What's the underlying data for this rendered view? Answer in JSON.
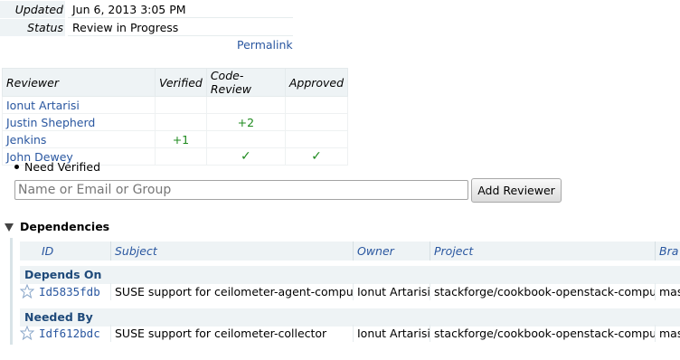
{
  "info": {
    "updated_label": "Updated",
    "updated_value": "Jun 6, 2013 3:05 PM",
    "status_label": "Status",
    "status_value": "Review in Progress",
    "permalink": "Permalink"
  },
  "reviewers": {
    "headers": [
      "Reviewer",
      "Verified",
      "Code-Review",
      "Approved"
    ],
    "rows": [
      {
        "name": "Ionut Artarisi",
        "verified": "",
        "code_review": "",
        "approved": ""
      },
      {
        "name": "Justin Shepherd",
        "verified": "",
        "code_review": "+2",
        "approved": ""
      },
      {
        "name": "Jenkins",
        "verified": "+1",
        "code_review": "",
        "approved": ""
      },
      {
        "name": "John Dewey",
        "verified": "",
        "code_review": "✓",
        "approved": "✓"
      }
    ]
  },
  "need_verified": "Need Verified",
  "add_reviewer": {
    "placeholder": "Name or Email or Group",
    "button": "Add Reviewer"
  },
  "dependencies": {
    "title": "Dependencies",
    "headers": [
      "ID",
      "Subject",
      "Owner",
      "Project",
      "Bra"
    ],
    "depends_on_label": "Depends On",
    "depends_on": [
      {
        "id": "Id5835fdb",
        "subject": "SUSE support for ceilometer-agent-compute",
        "owner": "Ionut Artarisi",
        "project": "stackforge/cookbook-openstack-compute",
        "branch": "mas"
      }
    ],
    "needed_by_label": "Needed By",
    "needed_by": [
      {
        "id": "Idf612bdc",
        "subject": "SUSE support for ceilometer-collector",
        "owner": "Ionut Artarisi",
        "project": "stackforge/cookbook-openstack-compute",
        "branch": "mas"
      }
    ]
  },
  "colors": {
    "link": "#2a57a0",
    "approval_green": "#1d8a1d",
    "header_bg": "#eef3f5"
  },
  "icons": [
    "star-icon",
    "collapse-triangle-icon"
  ]
}
